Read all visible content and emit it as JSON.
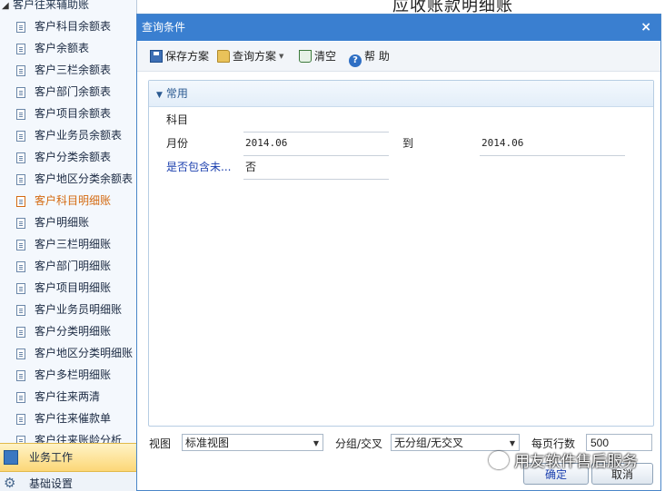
{
  "sidebar": {
    "group_label": "客户往来辅助账",
    "items": [
      {
        "label": "客户科目余额表",
        "active": false
      },
      {
        "label": "客户余额表",
        "active": false
      },
      {
        "label": "客户三栏余额表",
        "active": false
      },
      {
        "label": "客户部门余额表",
        "active": false
      },
      {
        "label": "客户项目余额表",
        "active": false
      },
      {
        "label": "客户业务员余额表",
        "active": false
      },
      {
        "label": "客户分类余额表",
        "active": false
      },
      {
        "label": "客户地区分类余额表",
        "active": false
      },
      {
        "label": "客户科目明细账",
        "active": true
      },
      {
        "label": "客户明细账",
        "active": false
      },
      {
        "label": "客户三栏明细账",
        "active": false
      },
      {
        "label": "客户部门明细账",
        "active": false
      },
      {
        "label": "客户项目明细账",
        "active": false
      },
      {
        "label": "客户业务员明细账",
        "active": false
      },
      {
        "label": "客户分类明细账",
        "active": false
      },
      {
        "label": "客户地区分类明细账",
        "active": false
      },
      {
        "label": "客户多栏明细账",
        "active": false
      },
      {
        "label": "客户往来两清",
        "active": false
      },
      {
        "label": "客户往来催款单",
        "active": false
      },
      {
        "label": "客户往来账龄分析",
        "active": false
      }
    ],
    "nav_business": "业务工作",
    "nav_base": "基础设置"
  },
  "report": {
    "title": "应收账款明细账"
  },
  "dialog": {
    "title": "查询条件",
    "close_glyph": "×",
    "toolbar": {
      "save_scheme": "保存方案",
      "query_scheme": "查询方案",
      "clear": "清空",
      "help": "帮 助"
    },
    "panel": {
      "header": "常用",
      "fields": {
        "subject_label": "科目",
        "subject_value": "",
        "month_label": "月份",
        "month_from": "2014.06",
        "to_label": "到",
        "month_to": "2014.06",
        "include_label": "是否包含未...",
        "include_value": "否"
      }
    },
    "bottom": {
      "view_label": "视图",
      "view_value": "标准视图",
      "group_label": "分组/交叉",
      "group_value": "无分组/无交叉",
      "rows_label": "每页行数",
      "rows_value": "500"
    },
    "ok_label": "确定",
    "cancel_label": "取消"
  },
  "watermark": "用友软件售后服务",
  "colors": {
    "titlebar": "#3a7fd0",
    "active_item": "#d46a11",
    "link_label": "#1b3fae"
  }
}
